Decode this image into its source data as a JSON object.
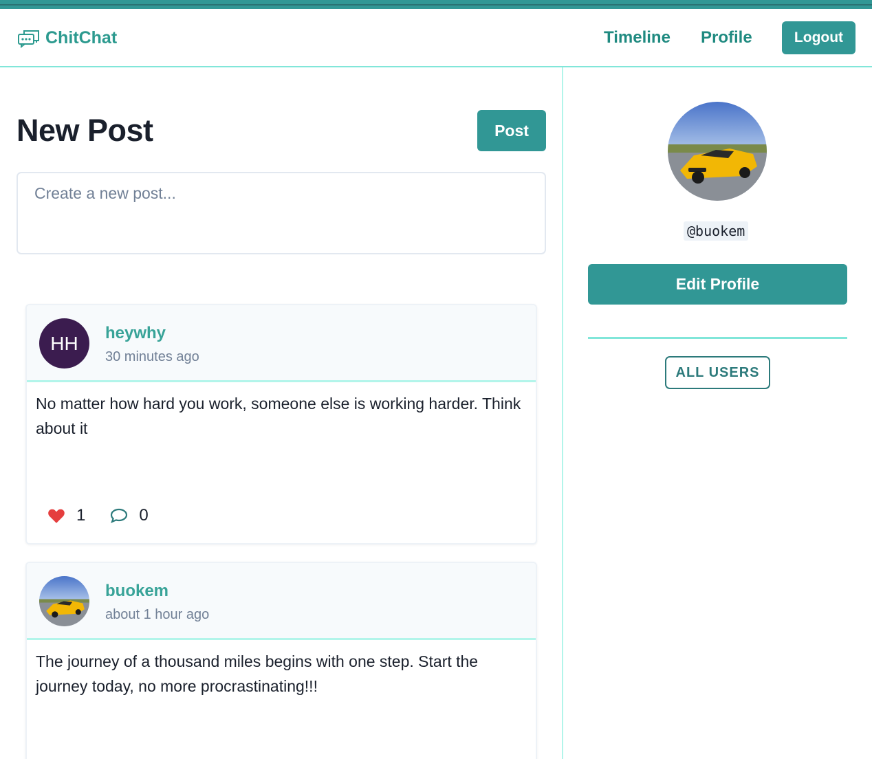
{
  "app": {
    "name": "ChitChat",
    "logo_icon": "chat-bubbles-icon"
  },
  "nav": {
    "timeline": "Timeline",
    "profile": "Profile",
    "logout": "Logout"
  },
  "colors": {
    "accent": "#319795",
    "accent_light": "#b2f5ea",
    "heart": "#e53e3e",
    "avatar_bg": "#3b1c4f"
  },
  "composer": {
    "title": "New Post",
    "post_button": "Post",
    "placeholder": "Create a new post..."
  },
  "posts": [
    {
      "username": "heywhy",
      "avatar_initials": "HH",
      "time": "30 minutes ago",
      "body": "No matter how hard you work, someone else is working harder. Think about it",
      "likes": "1",
      "comments": "0"
    },
    {
      "username": "buokem",
      "avatar_image": "yellow-sports-car-photo",
      "time": "about 1 hour ago",
      "body": "The journey of a thousand miles begins with one step. Start the journey today, no more procrastinating!!!",
      "likes": "",
      "comments": ""
    }
  ],
  "profile": {
    "handle": "@buokem",
    "avatar_image": "yellow-sports-car-photo",
    "edit_button": "Edit Profile",
    "all_users_button": "ALL USERS"
  }
}
